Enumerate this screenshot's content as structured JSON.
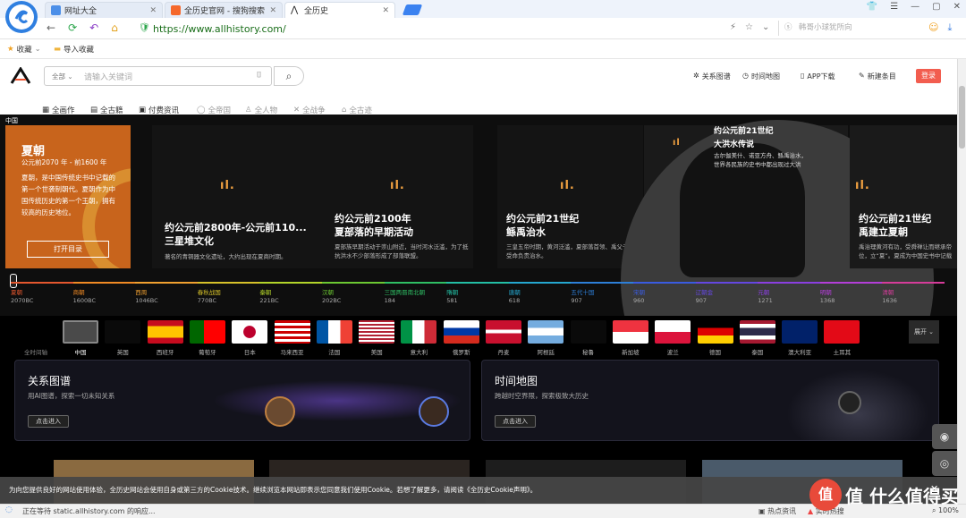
{
  "browser": {
    "tabs": [
      {
        "title": "网址大全",
        "active": false
      },
      {
        "title": "全历史官网 - 搜狗搜索",
        "active": false
      },
      {
        "title": "全历史",
        "active": true
      }
    ],
    "url": "https://www.allhistory.com/",
    "search_placeholder": "韩哥小球犹所向",
    "bookmarks": [
      "收藏",
      "导入收藏"
    ]
  },
  "site": {
    "search_scope": "全部",
    "search_placeholder": "请输入关键词",
    "header_links": [
      "关系图谱",
      "时间地图",
      "APP下载",
      "新建条目"
    ],
    "login_label": "登录",
    "nav": [
      "全画作",
      "全古籍",
      "付费资讯",
      "全帝国",
      "全人物",
      "全战争",
      "全古迹"
    ]
  },
  "hero": {
    "region_label": "中国",
    "featured": {
      "title": "夏朝",
      "dates": "公元前2070 年 - 前1600 年",
      "desc": "夏朝，是中国传统史书中记载的第一个世袭制朝代。夏朝作为中国传统历史的第一个王朝，拥有较高的历史地位。",
      "button": "打开目录"
    },
    "cards": [
      {
        "date": "约公元前2800年-公元前110...",
        "name": "三星堆文化",
        "desc": "著名的青铜器文化遗址，大约出现在夏商时期。"
      },
      {
        "date": "约公元前2100年",
        "name": "夏部落的早期活动",
        "desc": "夏部族早期活动于崇山附近，当时河水泛滥，为了抵抗洪水不少部落形成了部落联盟。"
      },
      {
        "date": "约公元前21世纪",
        "name": "鲧禹治水",
        "desc": "三皇五帝时期，黄河泛滥，夏部落首领、禹父子二人受命负责治水。"
      },
      {
        "date": "约公元前21世纪",
        "name": "大洪水传说",
        "desc": "古尔伽美什、诺亚方舟、鲧禹治水，世界各民族的史书中都出现过大洪"
      },
      {
        "date": "约公元前21世纪",
        "name": "禹建立夏朝",
        "desc": "禹治理黄河有功，受舜禅让而继承帝位，立“夏”。夏成为中国史书中记载的第一个世"
      }
    ],
    "timeline": [
      {
        "name": "夏朝",
        "year": "2070BC",
        "color": "#e4572e"
      },
      {
        "name": "商朝",
        "year": "1600BC",
        "color": "#f08a24"
      },
      {
        "name": "西周",
        "year": "1046BC",
        "color": "#f0a030"
      },
      {
        "name": "春秋战国",
        "year": "770BC",
        "color": "#d6c12a"
      },
      {
        "name": "秦朝",
        "year": "221BC",
        "color": "#b3d42a"
      },
      {
        "name": "汉朝",
        "year": "202BC",
        "color": "#6cc832"
      },
      {
        "name": "三国两晋南北朝",
        "year": "184",
        "color": "#2fbf64"
      },
      {
        "name": "隋朝",
        "year": "581",
        "color": "#23bfa5"
      },
      {
        "name": "唐朝",
        "year": "618",
        "color": "#25a7cf"
      },
      {
        "name": "五代十国",
        "year": "907",
        "color": "#2d7fd8"
      },
      {
        "name": "宋朝",
        "year": "960",
        "color": "#3a5be0"
      },
      {
        "name": "辽朝金",
        "year": "907",
        "color": "#6447e0"
      },
      {
        "name": "元朝",
        "year": "1271",
        "color": "#8a3fe0"
      },
      {
        "name": "明朝",
        "year": "1368",
        "color": "#b43ed8"
      },
      {
        "name": "清朝",
        "year": "1636",
        "color": "#d63c9a"
      }
    ]
  },
  "countries": {
    "all_label": "全时间轴",
    "items": [
      "中国",
      "英国",
      "西班牙",
      "葡萄牙",
      "日本",
      "马来西亚",
      "法国",
      "美国",
      "意大利",
      "俄罗斯",
      "丹麦",
      "阿根廷",
      "秘鲁",
      "新加坡",
      "波兰",
      "德国",
      "泰国",
      "澳大利亚",
      "土耳其"
    ],
    "expand_label": "展开"
  },
  "panels": [
    {
      "title": "关系图谱",
      "desc": "用AI图谱，探索一切未知关系",
      "button": "点击进入"
    },
    {
      "title": "时间地图",
      "desc": "跨越时空界限，探索极致大历史",
      "button": "点击进入"
    }
  ],
  "cookie": {
    "text": "为向您提供良好的网站使用体验，全历史网站会使用自身或第三方的Cookie技术。继续浏览本网站即表示您同意我们使用Cookie。若想了解更多，请阅读《全历史Cookie声明》。",
    "close": "✕"
  },
  "status": {
    "loading": "正在等待 static.allhistory.com 的响应...",
    "right": [
      "热点资讯",
      "实时热搜",
      "100%"
    ]
  },
  "watermark": "值 什么值得买",
  "colors": {
    "accent": "#f25d4f",
    "orange_card": "#c8641c"
  }
}
